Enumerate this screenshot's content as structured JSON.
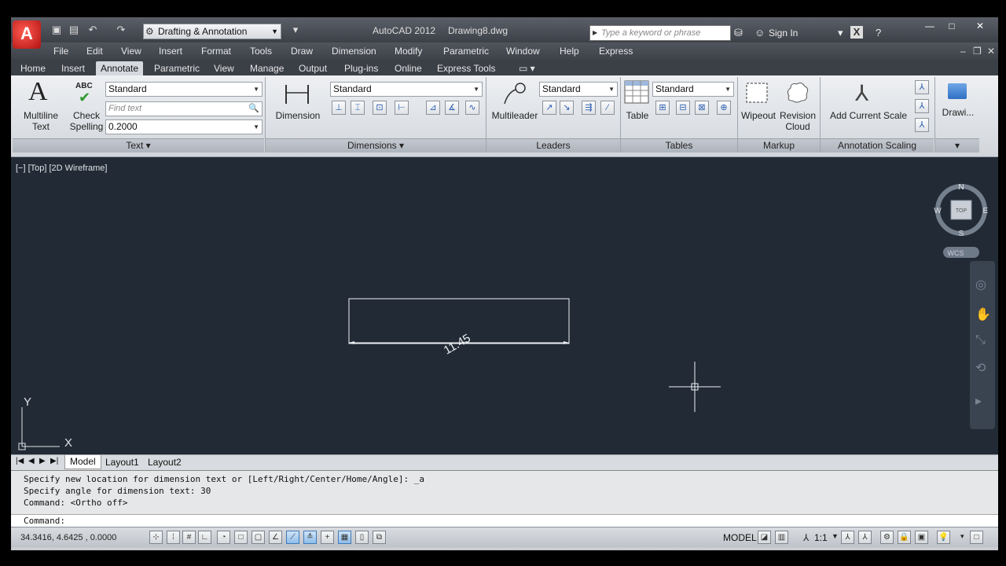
{
  "titlebar": {
    "workspace": "Drafting & Annotation",
    "app_title": "AutoCAD 2012",
    "file_name": "Drawing8.dwg",
    "search_placeholder": "Type a keyword or phrase",
    "sign_in": "Sign In"
  },
  "menubar": [
    "File",
    "Edit",
    "View",
    "Insert",
    "Format",
    "Tools",
    "Draw",
    "Dimension",
    "Modify",
    "Parametric",
    "Window",
    "Help",
    "Express"
  ],
  "ribbon_tabs": [
    "Home",
    "Insert",
    "Annotate",
    "Parametric",
    "View",
    "Manage",
    "Output",
    "Plug-ins",
    "Online",
    "Express Tools"
  ],
  "ribbon_active_tab": "Annotate",
  "panels": {
    "text": {
      "footer": "Text",
      "multiline_1": "Multiline",
      "multiline_2": "Text",
      "check_1": "Check",
      "check_2": "Spelling",
      "check_badge": "ABC",
      "style": "Standard",
      "find_placeholder": "Find text",
      "height": "0.2000"
    },
    "dimensions": {
      "footer": "Dimensions",
      "button": "Dimension",
      "style": "Standard"
    },
    "leaders": {
      "footer": "Leaders",
      "button": "Multileader",
      "style": "Standard"
    },
    "tables": {
      "footer": "Tables",
      "button": "Table",
      "style": "Standard"
    },
    "markup": {
      "footer": "Markup",
      "wipeout": "Wipeout",
      "revision_1": "Revision",
      "revision_2": "Cloud"
    },
    "annotation_scaling": {
      "footer": "Annotation Scaling",
      "add_scale": "Add Current Scale"
    },
    "drawing": {
      "button": "Drawi..."
    }
  },
  "canvas": {
    "viewport_label": "[−] [Top] [2D Wireframe]",
    "dimension_text": "11.45",
    "viewcube": {
      "n": "N",
      "s": "S",
      "e": "E",
      "w": "W",
      "face": "TOP",
      "wcs": "WCS"
    },
    "ucs": {
      "x": "X",
      "y": "Y"
    }
  },
  "layout_tabs": [
    "Model",
    "Layout1",
    "Layout2"
  ],
  "command_history": [
    "Specify new location for dimension text or [Left/Right/Center/Home/Angle]: _a",
    "Specify angle for dimension text: 30",
    "Command:  <Ortho off>"
  ],
  "command_prompt": "Command:",
  "statusbar": {
    "coords": "34.3416, 4.6425 , 0.0000",
    "model": "MODEL",
    "scale": "1:1"
  }
}
